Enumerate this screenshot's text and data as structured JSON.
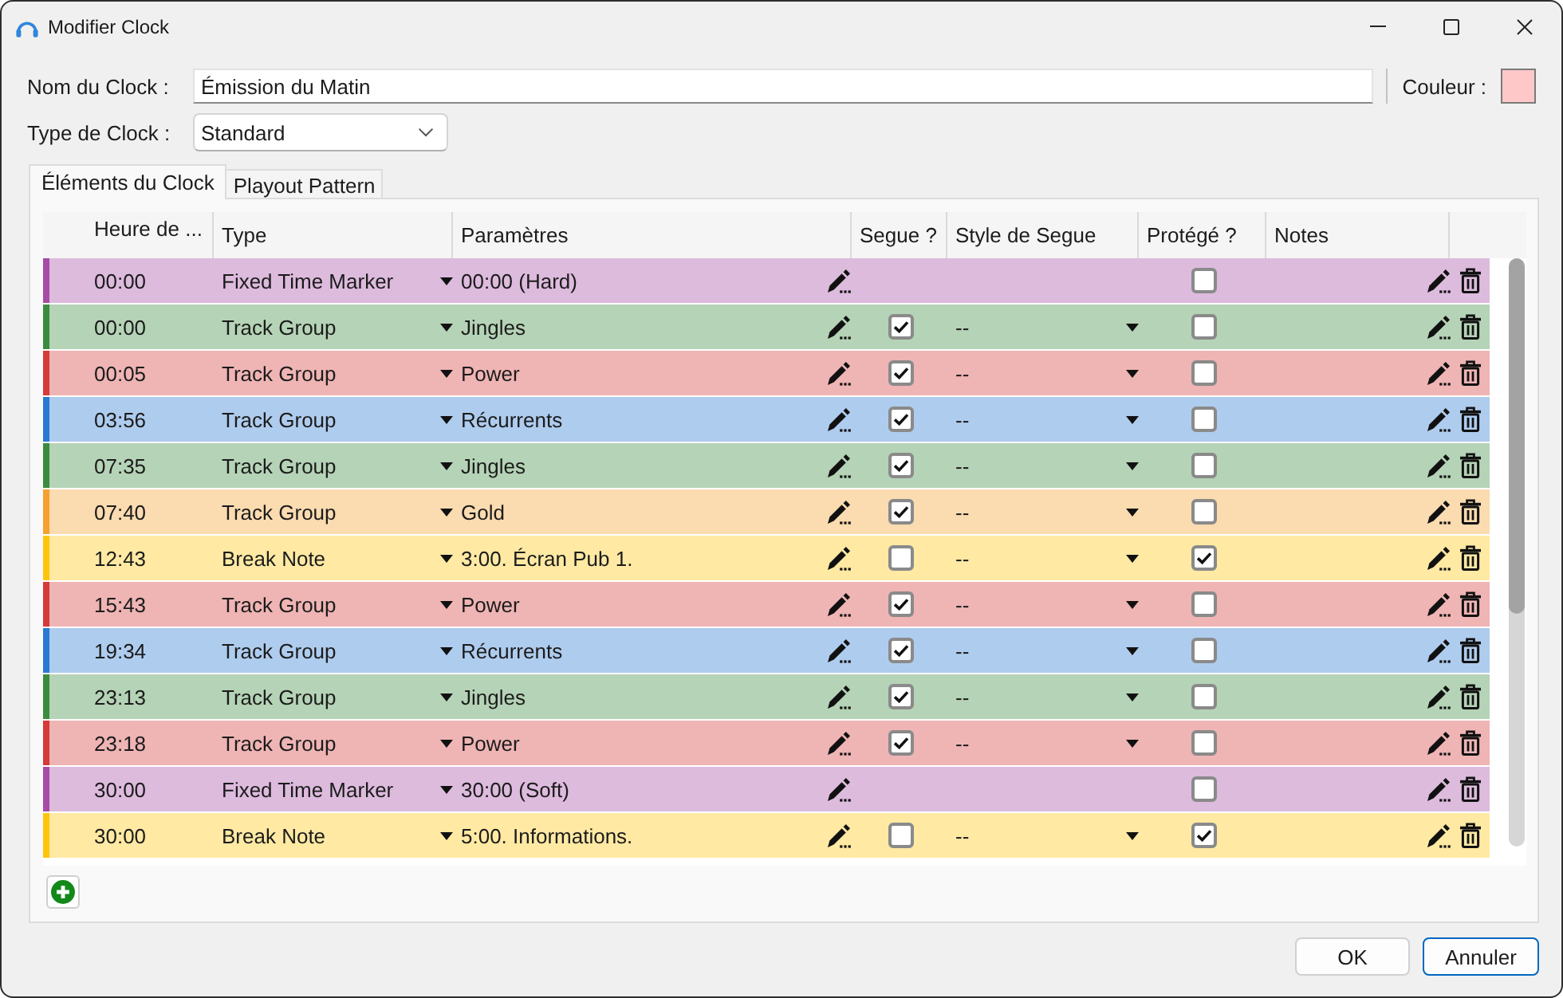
{
  "window": {
    "title": "Modifier Clock"
  },
  "form": {
    "name": {
      "label": "Nom du Clock :",
      "value": "Émission du Matin"
    },
    "color": {
      "label": "Couleur :",
      "color": "#ffc8c8"
    },
    "type": {
      "label": "Type de Clock :",
      "value": "Standard"
    }
  },
  "tabs": [
    {
      "label": "Éléments du Clock",
      "selected": true
    },
    {
      "label": "Playout Pattern",
      "selected": false
    }
  ],
  "table": {
    "columns": [
      "Heure de ...",
      "Type",
      "Paramètres",
      "Segue ?",
      "Style de Segue",
      "Protégé ?",
      "Notes"
    ],
    "rows": [
      {
        "kind": "marker",
        "color": "#a64ca6",
        "time": "00:00",
        "type": "Fixed Time Marker",
        "parameter": "00:00 (Hard)",
        "protected": false
      },
      {
        "kind": "item",
        "color": "#3c8c40",
        "time": "00:00",
        "type": "Track Group",
        "parameter": "Jingles",
        "segue": true,
        "segue_style": "--",
        "protected": false
      },
      {
        "kind": "item",
        "color": "#d63a3a",
        "time": "00:05",
        "type": "Track Group",
        "parameter": "Power",
        "segue": true,
        "segue_style": "--",
        "protected": false
      },
      {
        "kind": "item",
        "color": "#2a7ad2",
        "time": "03:56",
        "type": "Track Group",
        "parameter": "Récurrents",
        "segue": true,
        "segue_style": "--",
        "protected": false
      },
      {
        "kind": "item",
        "color": "#3c8c40",
        "time": "07:35",
        "type": "Track Group",
        "parameter": "Jingles",
        "segue": true,
        "segue_style": "--",
        "protected": false
      },
      {
        "kind": "item",
        "color": "#f5a030",
        "time": "07:40",
        "type": "Track Group",
        "parameter": "Gold",
        "segue": true,
        "segue_style": "--",
        "protected": false
      },
      {
        "kind": "item",
        "color": "#ffc40c",
        "time": "12:43",
        "type": "Break Note",
        "parameter": "3:00. Écran Pub 1.",
        "segue": false,
        "segue_style": "--",
        "protected": true
      },
      {
        "kind": "item",
        "color": "#d63a3a",
        "time": "15:43",
        "type": "Track Group",
        "parameter": "Power",
        "segue": true,
        "segue_style": "--",
        "protected": false
      },
      {
        "kind": "item",
        "color": "#2a7ad2",
        "time": "19:34",
        "type": "Track Group",
        "parameter": "Récurrents",
        "segue": true,
        "segue_style": "--",
        "protected": false
      },
      {
        "kind": "item",
        "color": "#3c8c40",
        "time": "23:13",
        "type": "Track Group",
        "parameter": "Jingles",
        "segue": true,
        "segue_style": "--",
        "protected": false
      },
      {
        "kind": "item",
        "color": "#d63a3a",
        "time": "23:18",
        "type": "Track Group",
        "parameter": "Power",
        "segue": true,
        "segue_style": "--",
        "protected": false
      },
      {
        "kind": "marker",
        "color": "#a64ca6",
        "time": "30:00",
        "type": "Fixed Time Marker",
        "parameter": "30:00 (Soft)",
        "protected": false
      },
      {
        "kind": "item",
        "color": "#ffc40c",
        "time": "30:00",
        "type": "Break Note",
        "parameter": "5:00. Informations.",
        "segue": false,
        "segue_style": "--",
        "protected": true
      }
    ]
  },
  "buttons": [
    {
      "label": "OK",
      "default": false
    },
    {
      "label": "Annuler",
      "default": true
    }
  ]
}
